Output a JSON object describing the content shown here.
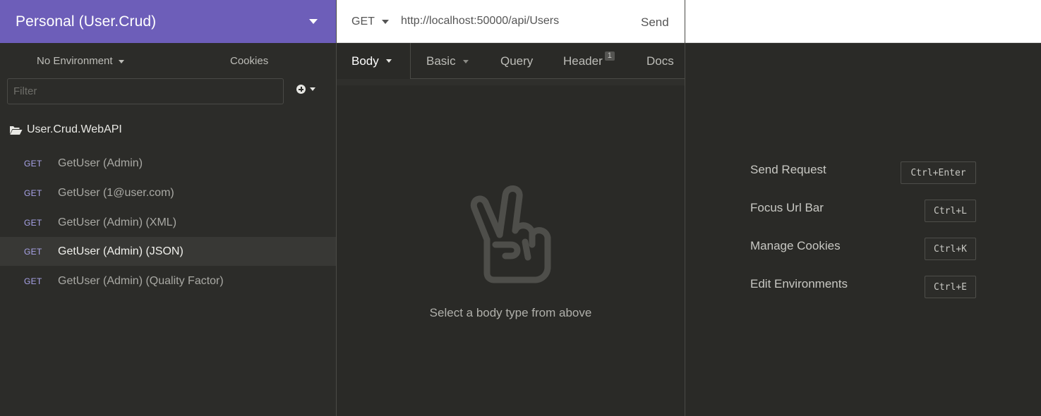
{
  "workspace": {
    "title": "Personal (User.Crud)"
  },
  "environment": {
    "selected": "No Environment",
    "cookies_label": "Cookies"
  },
  "filter": {
    "placeholder": "Filter"
  },
  "tree": {
    "folder": "User.Crud.WebAPI",
    "requests": [
      {
        "method": "GET",
        "name": "GetUser (Admin)",
        "active": false
      },
      {
        "method": "GET",
        "name": "GetUser (1@user.com)",
        "active": false
      },
      {
        "method": "GET",
        "name": "GetUser (Admin) (XML)",
        "active": false
      },
      {
        "method": "GET",
        "name": "GetUser (Admin) (JSON)",
        "active": true
      },
      {
        "method": "GET",
        "name": "GetUser (Admin) (Quality Factor)",
        "active": false
      }
    ]
  },
  "request": {
    "method": "GET",
    "url": "http://localhost:50000/api/Users",
    "send_label": "Send",
    "tabs": {
      "body": "Body",
      "auth": "Basic",
      "query": "Query",
      "header": "Header",
      "header_count": "1",
      "docs": "Docs"
    },
    "empty_hint": "Select a body type from above"
  },
  "shortcuts": [
    {
      "label": "Send Request",
      "keys": "Ctrl+Enter"
    },
    {
      "label": "Focus Url Bar",
      "keys": "Ctrl+L"
    },
    {
      "label": "Manage Cookies",
      "keys": "Ctrl+K"
    },
    {
      "label": "Edit Environments",
      "keys": "Ctrl+E"
    }
  ],
  "icons": {
    "workspace_menu": "chevron-down-icon",
    "add": "plus-circle-icon",
    "folder": "folder-open-icon",
    "empty_state": "peace-hand-icon"
  },
  "colors": {
    "accent": "#6d5eb9",
    "method_get": "#a8a3e8",
    "background": "#2a2a27"
  }
}
